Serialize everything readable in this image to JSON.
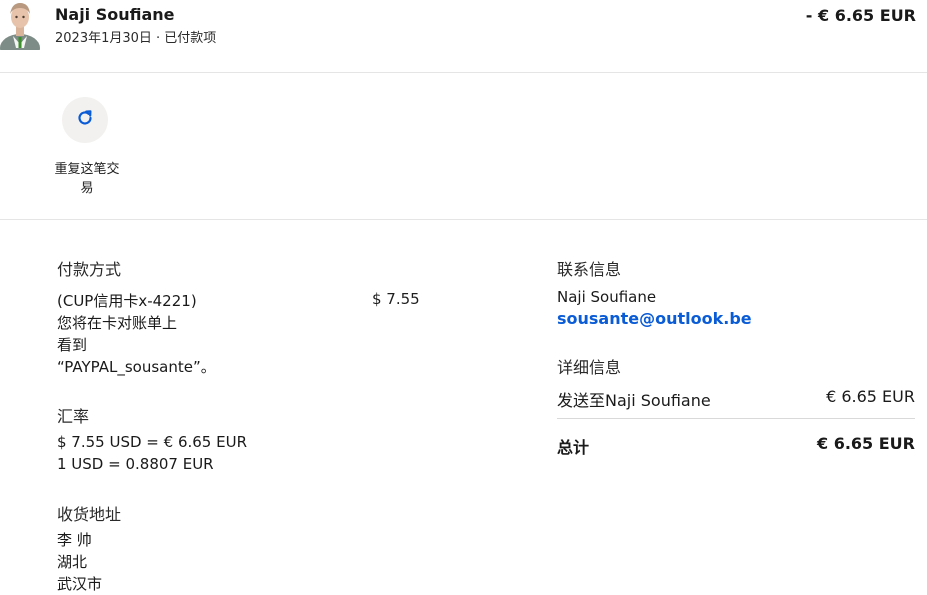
{
  "header": {
    "name": "Naji Soufiane",
    "subtitle": "2023年1月30日 · 已付款项",
    "amount": "- € 6.65 EUR"
  },
  "actions": {
    "repeat_label": "重复这笔交易",
    "repeat_icon": "refresh-icon"
  },
  "payment": {
    "title": "付款方式",
    "method_lines": [
      "(CUP信用卡x-4221)",
      "您将在卡对账单上",
      "看到",
      "“PAYPAL_sousante”。"
    ],
    "amount": "$ 7.55"
  },
  "exchange": {
    "title": "汇率",
    "line1": "$ 7.55 USD = € 6.65 EUR",
    "line2": "1 USD = 0.8807 EUR"
  },
  "shipping": {
    "title": "收货地址",
    "lines": [
      "李 帅",
      "湖北",
      "武汉市"
    ]
  },
  "contact": {
    "title": "联系信息",
    "name": "Naji Soufiane",
    "email": "sousante@outlook.be"
  },
  "details": {
    "title": "详细信息",
    "sent_label": "发送至Naji Soufiane",
    "sent_value": "€ 6.65 EUR",
    "total_label": "总计",
    "total_value": "€ 6.65 EUR"
  },
  "colors": {
    "link": "#0a5bd6",
    "button_bg": "#f2f1ef"
  }
}
